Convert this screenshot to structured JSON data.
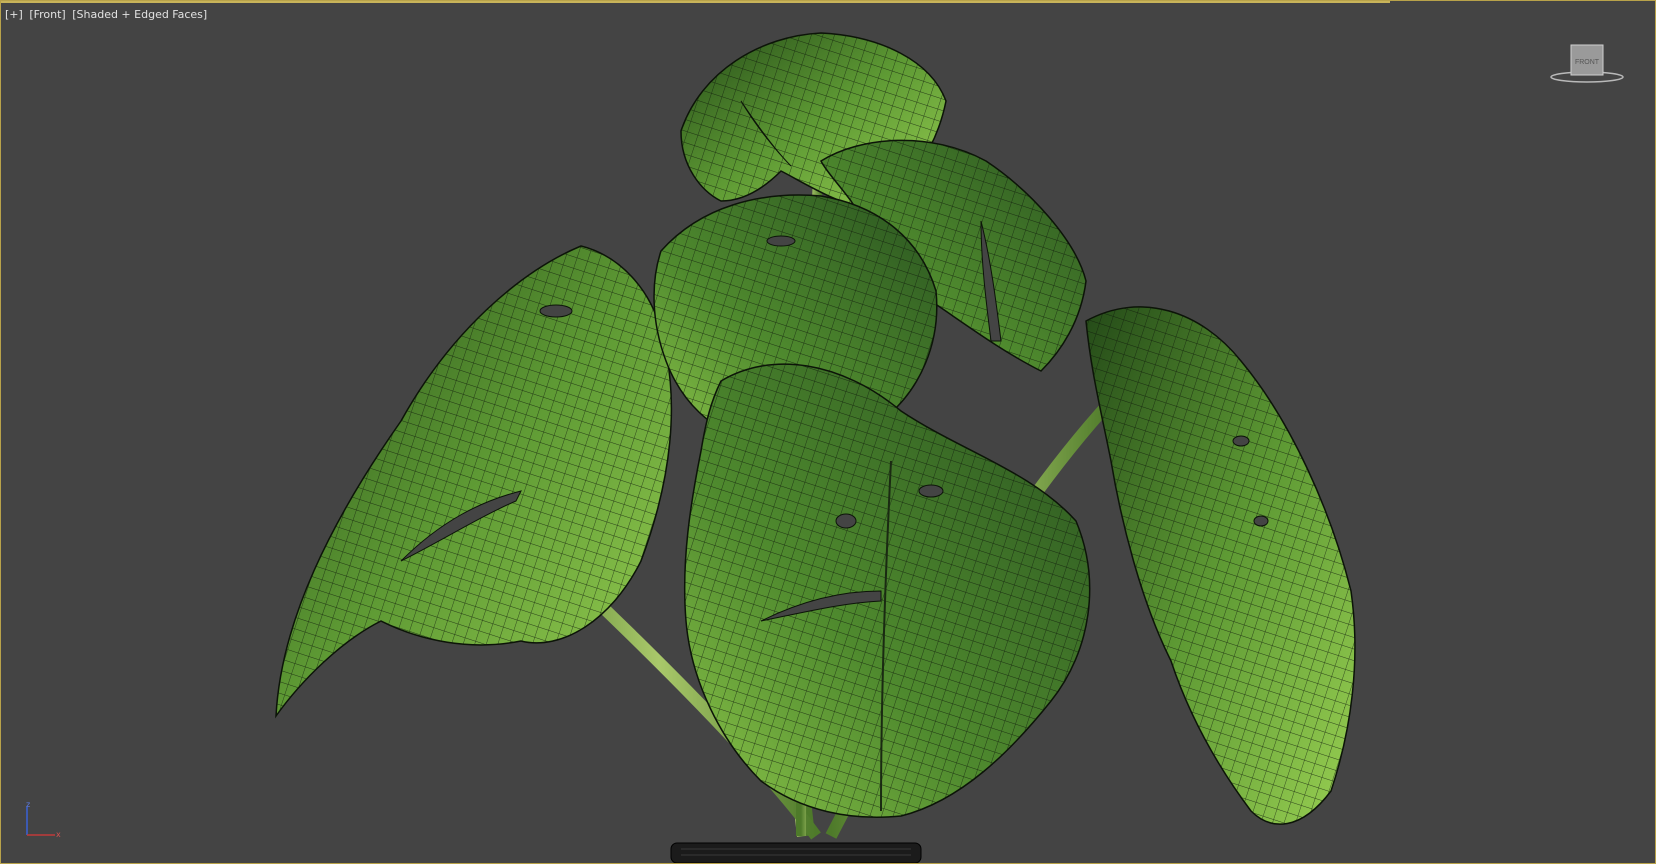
{
  "viewport": {
    "labels": [
      "[+]",
      "[Front]",
      "[Shaded + Edged Faces]"
    ],
    "viewcube_face": "FRONT",
    "axis": {
      "z": "z",
      "x": "x"
    }
  },
  "colors": {
    "background": "#444444",
    "border": "#b8a24a",
    "leaf_dark": "#2d5a1f",
    "leaf_light": "#8fc54a",
    "wire": "#101a0c"
  },
  "icons": [
    "viewcube-icon",
    "axis-gizmo-icon"
  ]
}
